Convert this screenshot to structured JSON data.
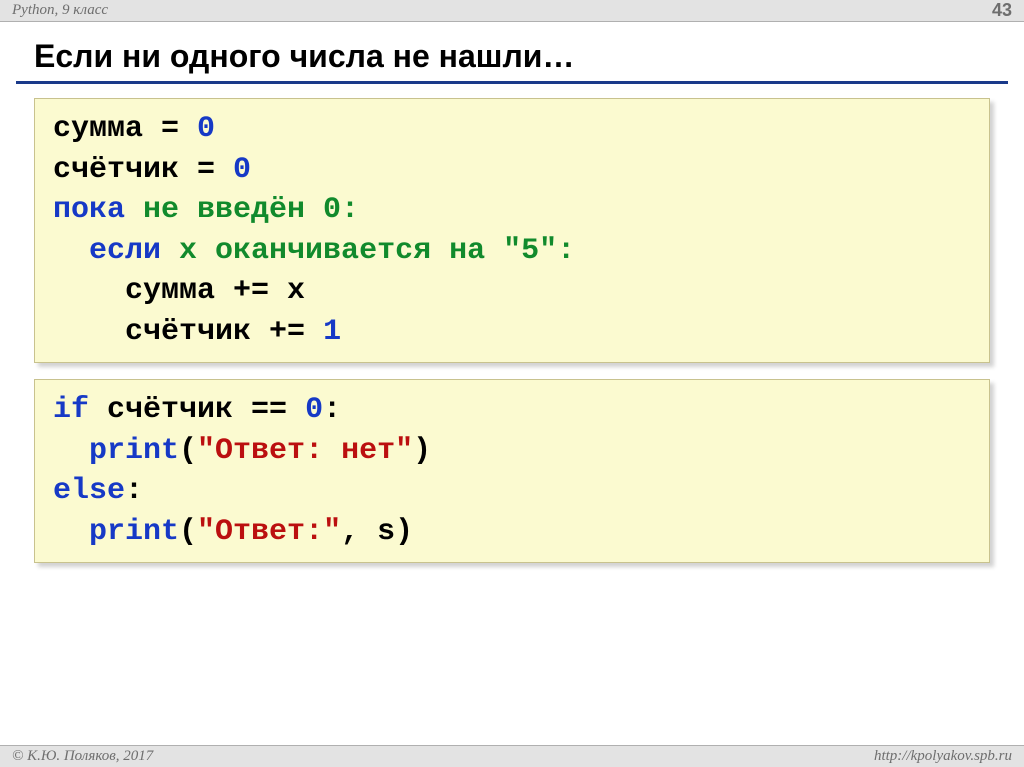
{
  "header": {
    "left": "Python, 9 класс",
    "page": "43"
  },
  "title": "Если ни одного числа не нашли…",
  "code1": {
    "l1a": "сумма",
    "l1b": " = ",
    "l1c": "0",
    "l2a": "счётчик",
    "l2b": " = ",
    "l2c": "0",
    "l3a": "пока",
    "l3b": " не введён 0:",
    "l4a": "  если",
    "l4b": " x оканчивается на \"5\":",
    "l5": "    сумма += x",
    "l6a": "    счётчик",
    "l6b": " += ",
    "l6c": "1"
  },
  "code2": {
    "l1a": "if",
    "l1b": " счётчик",
    "l1c": " == ",
    "l1d": "0",
    "l1e": ":",
    "l2a": "  print",
    "l2b": "(",
    "l2c": "\"Ответ: нет\"",
    "l2d": ")",
    "l3a": "else",
    "l3b": ":",
    "l4a": "  print",
    "l4b": "(",
    "l4c": "\"Ответ:\"",
    "l4d": ", s)"
  },
  "footer": {
    "left": "© К.Ю. Поляков, 2017",
    "right": "http://kpolyakov.spb.ru"
  }
}
